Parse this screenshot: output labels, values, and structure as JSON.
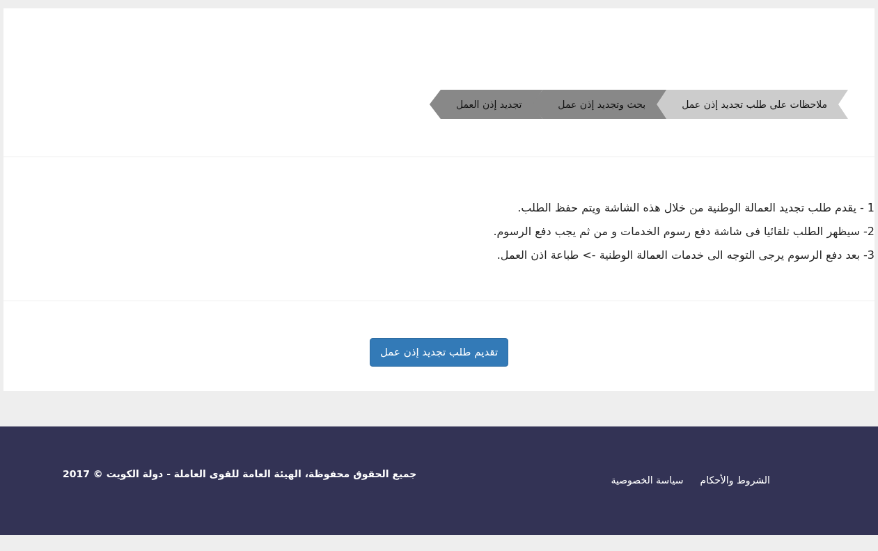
{
  "steps": [
    {
      "label": "ملاحظات على طلب تجديد إذن عمل",
      "selected": true
    },
    {
      "label": "بحث وتجديد إذن عمل",
      "selected": false
    },
    {
      "label": "تجديد إذن العمل",
      "selected": false
    }
  ],
  "notes": [
    "1 - يقدم طلب تجديد العمالة الوطنية من خلال هذه الشاشة ويتم حفظ الطلب.",
    "2- سيظهر الطلب تلقائيا فى شاشة دفع رسوم الخدمات و من ثم يجب دفع الرسوم.",
    "3- بعد دفع الرسوم يرجى التوجه الى خدمات العمالة الوطنية -> طباعة اذن العمل."
  ],
  "submit_button": "تقديم طلب تجديد إذن عمل",
  "footer": {
    "links": [
      "الشروط والأحكام",
      "سياسة الخصوصية"
    ],
    "copyright": "جميع الحقوق محفوظة، الهيئة العامة للقوى العاملة - دولة الكويت © 2017"
  }
}
